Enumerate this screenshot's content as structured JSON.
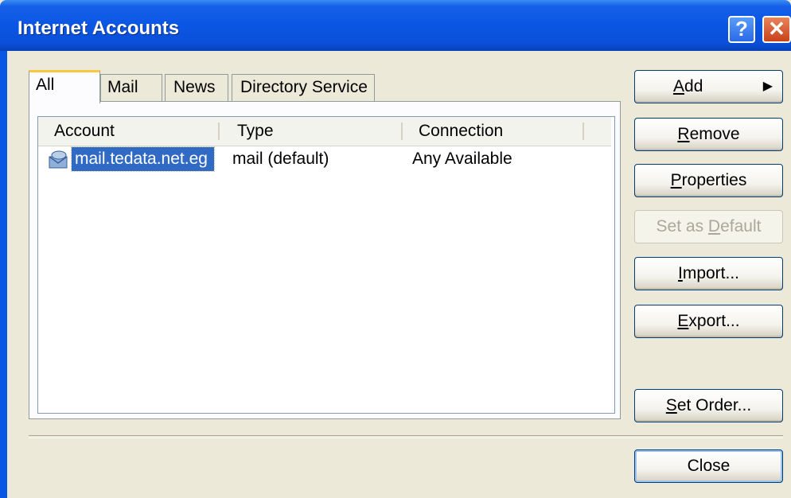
{
  "window": {
    "title": "Internet Accounts",
    "help_glyph": "?",
    "close_glyph": "✕"
  },
  "tabs": [
    "All",
    "Mail",
    "News",
    "Directory Service"
  ],
  "list": {
    "columns": [
      "Account",
      "Type",
      "Connection"
    ],
    "rows": [
      {
        "account": "mail.tedata.net.eg",
        "type": "mail (default)",
        "connection": "Any Available",
        "icon": "mail-account-icon"
      }
    ]
  },
  "buttons": {
    "add": {
      "mn": "A",
      "rest": "dd",
      "arrow": "▶"
    },
    "remove": {
      "mn": "R",
      "rest": "emove"
    },
    "properties": {
      "mn": "P",
      "rest": "roperties"
    },
    "set_default": {
      "pre": "Set as ",
      "mn": "D",
      "rest": "efault"
    },
    "import": {
      "mn": "I",
      "rest": "mport..."
    },
    "export": {
      "mn": "E",
      "rest": "xport..."
    },
    "set_order": {
      "mn": "S",
      "rest": "et Order..."
    },
    "close": {
      "label": "Close"
    }
  },
  "colors": {
    "titlebar": "#0a56e4",
    "selection": "#316ac5",
    "dialog_bg": "#ece9d8"
  }
}
